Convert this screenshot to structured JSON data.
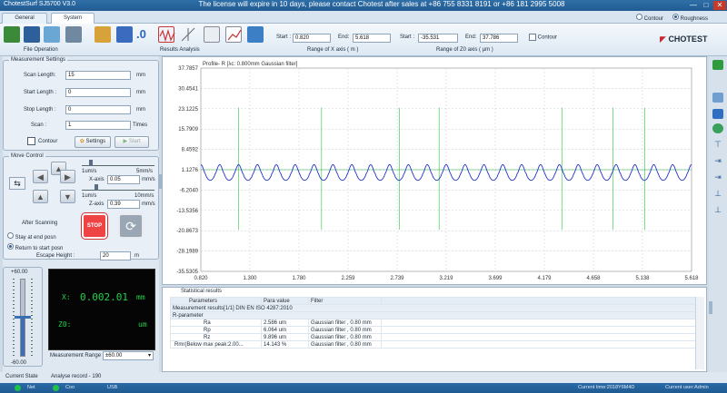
{
  "window": {
    "app_title": "ChotestSurf SJ5700 V3.0",
    "license_message": "The license will expire in 10 days, please contact Chotest after sales at +86 755 8331 8191 or +86 181 2995 5008",
    "min_symbol": "—",
    "max_symbol": "□",
    "close_symbol": "✕"
  },
  "tabs": [
    {
      "label": "General",
      "active": false
    },
    {
      "label": "System",
      "active": true
    }
  ],
  "mode": {
    "contour_label": "Contour",
    "roughness_label": "Roughness",
    "selected": "roughness"
  },
  "toolbar": {
    "file_operation_label": "File Operation",
    "results_analysis_label": "Results Analysis",
    "x_range": {
      "start_label": "Start :",
      "start_value": "0.820",
      "end_label": "End:",
      "end_value": "5.618",
      "caption": "Range of X axis ( m )"
    },
    "z_range": {
      "start_label": "Start :",
      "start_value": "-35.531",
      "end_label": "End:",
      "end_value": "37.786",
      "caption": "Range of Z0 axis ( μm )"
    },
    "contour_checkbox_label": "Contour",
    "brand": "CHOTEST"
  },
  "measurement_settings": {
    "title": "Measurement Settings",
    "scan_length_label": "Scan Length:",
    "scan_length_value": "15",
    "scan_length_unit": "mm",
    "start_length_label": "Start Length :",
    "start_length_value": "0",
    "start_length_unit": "mm",
    "stop_length_label": "Stop Length :",
    "stop_length_value": "0",
    "stop_length_unit": "mm",
    "scan_label": "Scan :",
    "scan_value": "1",
    "scan_unit": "Times",
    "contour_label": "Contour",
    "settings_button": "Settings",
    "start_button": "Start"
  },
  "move_control": {
    "title": "Move Control",
    "x_slider_min": "1um/s",
    "x_slider_max": "5mm/s",
    "x_axis_label": "X-axis",
    "x_axis_value": "0.05",
    "x_axis_unit": "mm/s",
    "z_slider_min": "1um/s",
    "z_slider_max": "10mm/s",
    "z_axis_label": "Z-axis",
    "z_axis_value": "0.39",
    "z_axis_unit": "mm/s",
    "after_scanning_label": "After Scanning",
    "stop_button": "STOP",
    "stay_label": "Stay at end posn",
    "return_label": "Return to start posn",
    "return_selected": true,
    "escape_height_label": "Escape Height :",
    "escape_height_value": "20",
    "escape_height_unit": "m"
  },
  "gauge": {
    "top_label": "+60.00",
    "bottom_label": "-60.00",
    "level": 0.52
  },
  "readout": {
    "x_label": "X:",
    "x_value": "0.002.01",
    "x_unit": "mm",
    "z_label": "Z0:",
    "z_unit": "um"
  },
  "measurement_range": {
    "label": "Measurement Range",
    "value": "±60.00"
  },
  "current_state": {
    "label": "Current State",
    "record": "Analyse record - 190"
  },
  "chart_data": {
    "type": "line",
    "title": "Profile- R [λc:  0.800mm Gaussian filter]",
    "x_ticks": [
      "0.820",
      "1.300",
      "1.780",
      "2.259",
      "2.739",
      "3.219",
      "3.699",
      "4.179",
      "4.658",
      "5.138",
      "5.618"
    ],
    "y_ticks": [
      "37.7857",
      "30.4541",
      "23.1225",
      "15.7909",
      "8.4592",
      "1.1276",
      "-6.2040",
      "-13.5356",
      "-20.8673",
      "-28.1989",
      "-35.5305"
    ],
    "xlim": [
      0.82,
      5.618
    ],
    "ylim": [
      -35.5305,
      37.7857
    ],
    "series": [
      {
        "color": "#2233cc",
        "periods": 26,
        "amplitude": 2.7,
        "offset": -0.4
      }
    ],
    "baseline": {
      "value": 1.1276,
      "color": "#22aa44"
    },
    "markers_color": "#44cc55",
    "markers_x": [
      1.19,
      2.76,
      4.35,
      5.16
    ],
    "markers_x_upper": [
      2.0,
      3.15,
      4.85
    ]
  },
  "stats": {
    "title": "Statistical results",
    "headers": [
      "Parameters",
      "Para value",
      "Filter"
    ],
    "measurement_row": "Measurement results[1/1] DIN EN ISO 4287:2010",
    "group_row": "R-parameter",
    "rows": [
      {
        "param": "Ra",
        "value": "2.586 um",
        "filter": "Gaussian filter , 0.80 mm"
      },
      {
        "param": "Rp",
        "value": "6.064 um",
        "filter": "Gaussian filter , 0.80 mm"
      },
      {
        "param": "Rz",
        "value": "9.896 um",
        "filter": "Gaussian filter , 0.80 mm"
      },
      {
        "param": "Rmr(Below max peak:2.00...",
        "value": "14.143 %",
        "filter": "Gaussian filter , 0.80 mm"
      }
    ]
  },
  "statusbar": {
    "net": "Net",
    "coo": "Coo",
    "usb": "USB",
    "current_time": "Current time:2018Y6M4D",
    "current_user": "Current user:Admin"
  }
}
